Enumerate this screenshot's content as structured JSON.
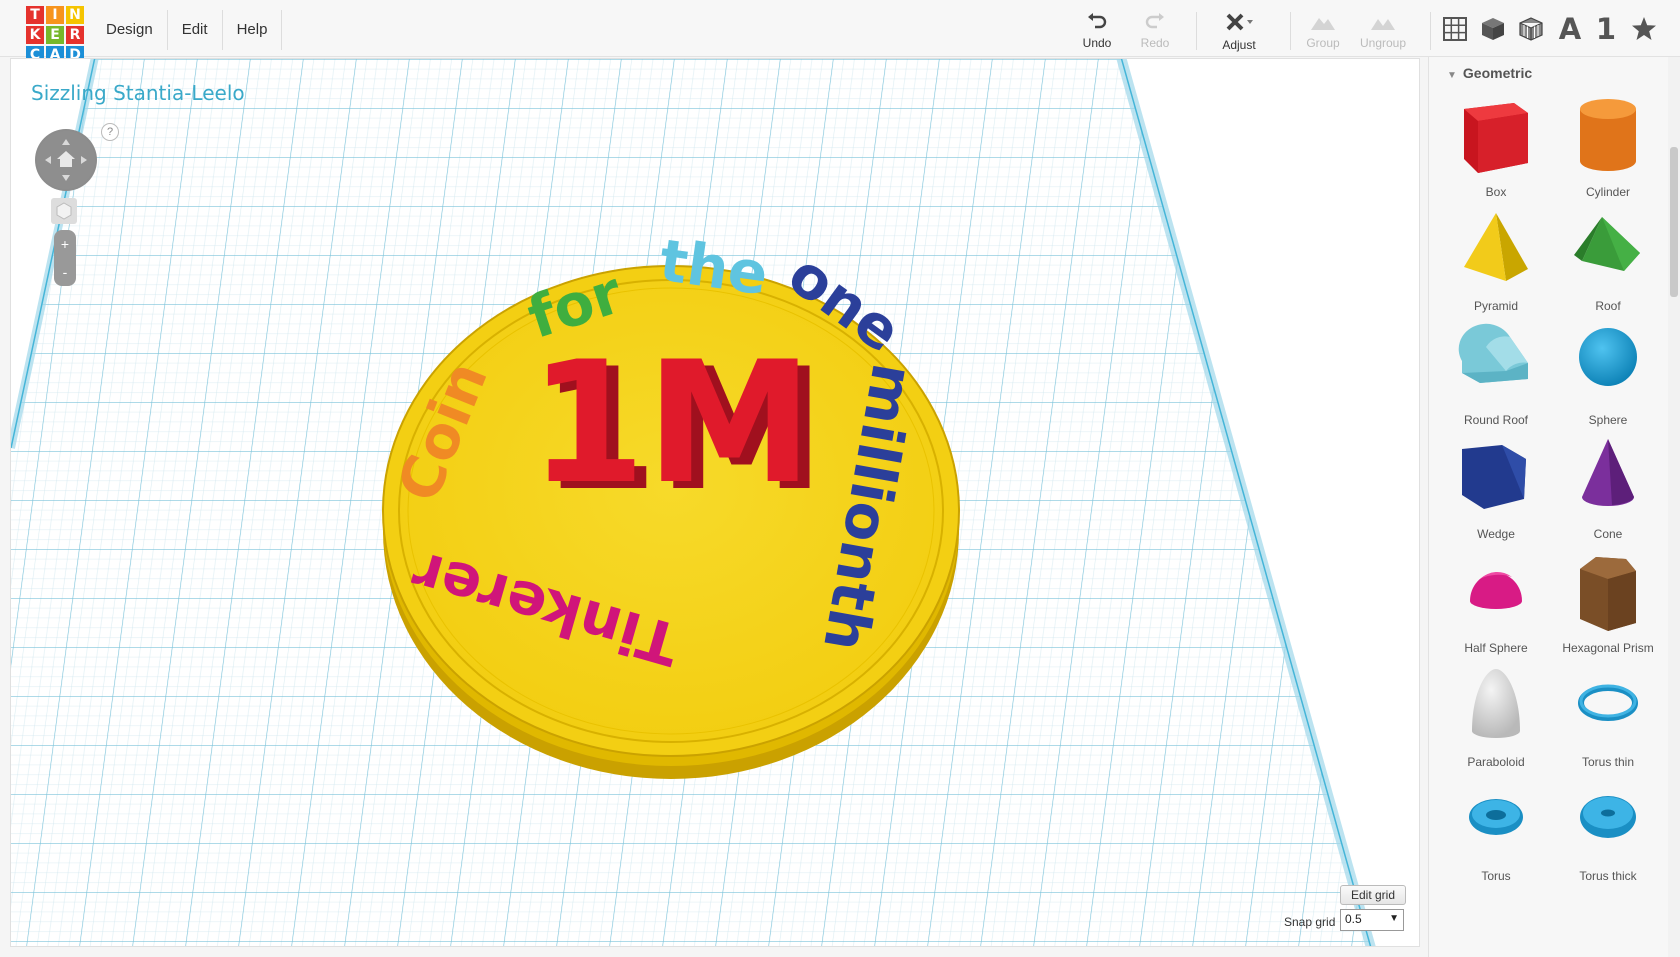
{
  "app": {
    "logo_letters": [
      "T",
      "I",
      "N",
      "K",
      "E",
      "R",
      "C",
      "A",
      "D"
    ],
    "logo_colors": [
      "#e5322d",
      "#f7941d",
      "#f5c400",
      "#e5322d",
      "#77b82a",
      "#e5322d",
      "#1c8fd7",
      "#1c8fd7",
      "#1c8fd7"
    ]
  },
  "menu": {
    "design": "Design",
    "edit": "Edit",
    "help": "Help"
  },
  "toolbar": {
    "undo": "Undo",
    "redo": "Redo",
    "adjust": "Adjust",
    "group": "Group",
    "ungroup": "Ungroup"
  },
  "view_icons": [
    "grid-icon",
    "cube-icon",
    "wireframe-cube-icon",
    "text-icon",
    "number-icon",
    "star-icon"
  ],
  "view_text": {
    "letter": "A",
    "number": "1"
  },
  "workplane": {
    "project_title": "Sizzling Stantia-Leelo",
    "help": "?",
    "zoom_in": "+",
    "zoom_out": "-",
    "edit_grid": "Edit grid",
    "snap_grid_label": "Snap grid",
    "snap_grid_value": "0.5"
  },
  "coin": {
    "center_text": "1M",
    "ring_words": [
      {
        "text": "Coin",
        "color": "#f08a24"
      },
      {
        "text": "for",
        "color": "#3fae3f"
      },
      {
        "text": "the",
        "color": "#5fc4e0"
      },
      {
        "text": "one",
        "color": "#2b3f9a"
      },
      {
        "text": "millionth",
        "color": "#2b3f9a"
      },
      {
        "text": "Tinkerer",
        "color": "#d0157a"
      }
    ],
    "face_color": "#f5d51c",
    "rim_color": "#e2b800",
    "center_color": "#e01a2b"
  },
  "panel": {
    "header": "Geometric",
    "shapes": [
      {
        "label": "Box",
        "icon": "box-icon"
      },
      {
        "label": "Cylinder",
        "icon": "cylinder-icon"
      },
      {
        "label": "Pyramid",
        "icon": "pyramid-icon"
      },
      {
        "label": "Roof",
        "icon": "roof-icon"
      },
      {
        "label": "Round Roof",
        "icon": "round-roof-icon"
      },
      {
        "label": "Sphere",
        "icon": "sphere-icon"
      },
      {
        "label": "Wedge",
        "icon": "wedge-icon"
      },
      {
        "label": "Cone",
        "icon": "cone-icon"
      },
      {
        "label": "Half Sphere",
        "icon": "half-sphere-icon"
      },
      {
        "label": "Hexagonal Prism",
        "icon": "hexagonal-prism-icon"
      },
      {
        "label": "Paraboloid",
        "icon": "paraboloid-icon"
      },
      {
        "label": "Torus thin",
        "icon": "torus-thin-icon"
      },
      {
        "label": "Torus",
        "icon": "torus-icon"
      },
      {
        "label": "Torus thick",
        "icon": "torus-thick-icon"
      }
    ]
  }
}
